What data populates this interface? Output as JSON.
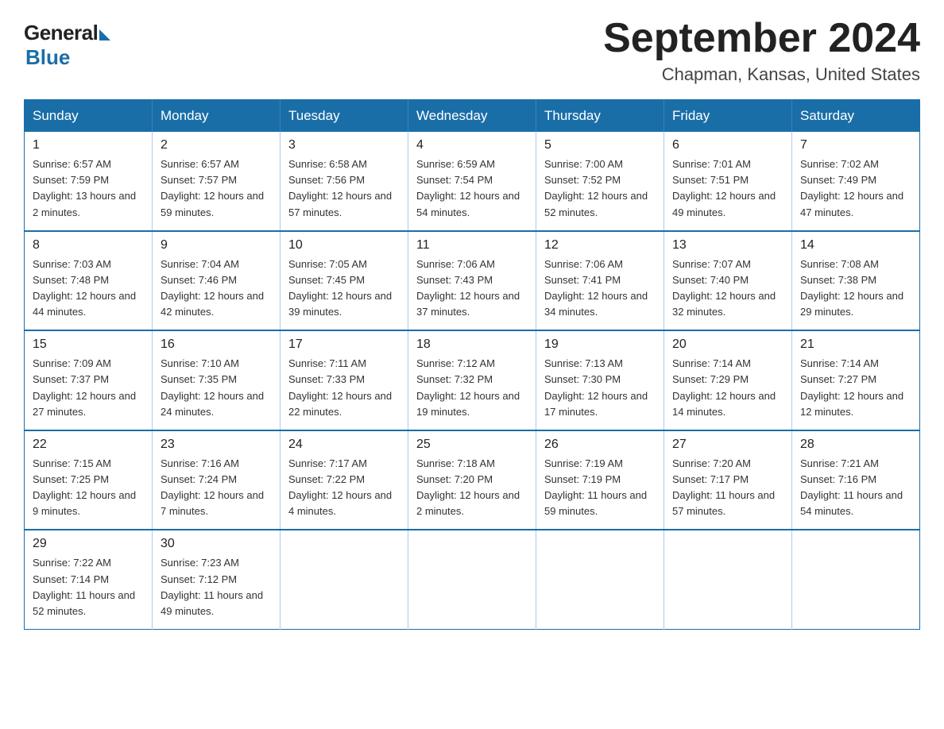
{
  "logo": {
    "general": "General",
    "blue": "Blue",
    "subtitle": "Blue"
  },
  "title": {
    "month_year": "September 2024",
    "location": "Chapman, Kansas, United States"
  },
  "days_of_week": [
    "Sunday",
    "Monday",
    "Tuesday",
    "Wednesday",
    "Thursday",
    "Friday",
    "Saturday"
  ],
  "weeks": [
    [
      {
        "day": "1",
        "sunrise": "Sunrise: 6:57 AM",
        "sunset": "Sunset: 7:59 PM",
        "daylight": "Daylight: 13 hours and 2 minutes."
      },
      {
        "day": "2",
        "sunrise": "Sunrise: 6:57 AM",
        "sunset": "Sunset: 7:57 PM",
        "daylight": "Daylight: 12 hours and 59 minutes."
      },
      {
        "day": "3",
        "sunrise": "Sunrise: 6:58 AM",
        "sunset": "Sunset: 7:56 PM",
        "daylight": "Daylight: 12 hours and 57 minutes."
      },
      {
        "day": "4",
        "sunrise": "Sunrise: 6:59 AM",
        "sunset": "Sunset: 7:54 PM",
        "daylight": "Daylight: 12 hours and 54 minutes."
      },
      {
        "day": "5",
        "sunrise": "Sunrise: 7:00 AM",
        "sunset": "Sunset: 7:52 PM",
        "daylight": "Daylight: 12 hours and 52 minutes."
      },
      {
        "day": "6",
        "sunrise": "Sunrise: 7:01 AM",
        "sunset": "Sunset: 7:51 PM",
        "daylight": "Daylight: 12 hours and 49 minutes."
      },
      {
        "day": "7",
        "sunrise": "Sunrise: 7:02 AM",
        "sunset": "Sunset: 7:49 PM",
        "daylight": "Daylight: 12 hours and 47 minutes."
      }
    ],
    [
      {
        "day": "8",
        "sunrise": "Sunrise: 7:03 AM",
        "sunset": "Sunset: 7:48 PM",
        "daylight": "Daylight: 12 hours and 44 minutes."
      },
      {
        "day": "9",
        "sunrise": "Sunrise: 7:04 AM",
        "sunset": "Sunset: 7:46 PM",
        "daylight": "Daylight: 12 hours and 42 minutes."
      },
      {
        "day": "10",
        "sunrise": "Sunrise: 7:05 AM",
        "sunset": "Sunset: 7:45 PM",
        "daylight": "Daylight: 12 hours and 39 minutes."
      },
      {
        "day": "11",
        "sunrise": "Sunrise: 7:06 AM",
        "sunset": "Sunset: 7:43 PM",
        "daylight": "Daylight: 12 hours and 37 minutes."
      },
      {
        "day": "12",
        "sunrise": "Sunrise: 7:06 AM",
        "sunset": "Sunset: 7:41 PM",
        "daylight": "Daylight: 12 hours and 34 minutes."
      },
      {
        "day": "13",
        "sunrise": "Sunrise: 7:07 AM",
        "sunset": "Sunset: 7:40 PM",
        "daylight": "Daylight: 12 hours and 32 minutes."
      },
      {
        "day": "14",
        "sunrise": "Sunrise: 7:08 AM",
        "sunset": "Sunset: 7:38 PM",
        "daylight": "Daylight: 12 hours and 29 minutes."
      }
    ],
    [
      {
        "day": "15",
        "sunrise": "Sunrise: 7:09 AM",
        "sunset": "Sunset: 7:37 PM",
        "daylight": "Daylight: 12 hours and 27 minutes."
      },
      {
        "day": "16",
        "sunrise": "Sunrise: 7:10 AM",
        "sunset": "Sunset: 7:35 PM",
        "daylight": "Daylight: 12 hours and 24 minutes."
      },
      {
        "day": "17",
        "sunrise": "Sunrise: 7:11 AM",
        "sunset": "Sunset: 7:33 PM",
        "daylight": "Daylight: 12 hours and 22 minutes."
      },
      {
        "day": "18",
        "sunrise": "Sunrise: 7:12 AM",
        "sunset": "Sunset: 7:32 PM",
        "daylight": "Daylight: 12 hours and 19 minutes."
      },
      {
        "day": "19",
        "sunrise": "Sunrise: 7:13 AM",
        "sunset": "Sunset: 7:30 PM",
        "daylight": "Daylight: 12 hours and 17 minutes."
      },
      {
        "day": "20",
        "sunrise": "Sunrise: 7:14 AM",
        "sunset": "Sunset: 7:29 PM",
        "daylight": "Daylight: 12 hours and 14 minutes."
      },
      {
        "day": "21",
        "sunrise": "Sunrise: 7:14 AM",
        "sunset": "Sunset: 7:27 PM",
        "daylight": "Daylight: 12 hours and 12 minutes."
      }
    ],
    [
      {
        "day": "22",
        "sunrise": "Sunrise: 7:15 AM",
        "sunset": "Sunset: 7:25 PM",
        "daylight": "Daylight: 12 hours and 9 minutes."
      },
      {
        "day": "23",
        "sunrise": "Sunrise: 7:16 AM",
        "sunset": "Sunset: 7:24 PM",
        "daylight": "Daylight: 12 hours and 7 minutes."
      },
      {
        "day": "24",
        "sunrise": "Sunrise: 7:17 AM",
        "sunset": "Sunset: 7:22 PM",
        "daylight": "Daylight: 12 hours and 4 minutes."
      },
      {
        "day": "25",
        "sunrise": "Sunrise: 7:18 AM",
        "sunset": "Sunset: 7:20 PM",
        "daylight": "Daylight: 12 hours and 2 minutes."
      },
      {
        "day": "26",
        "sunrise": "Sunrise: 7:19 AM",
        "sunset": "Sunset: 7:19 PM",
        "daylight": "Daylight: 11 hours and 59 minutes."
      },
      {
        "day": "27",
        "sunrise": "Sunrise: 7:20 AM",
        "sunset": "Sunset: 7:17 PM",
        "daylight": "Daylight: 11 hours and 57 minutes."
      },
      {
        "day": "28",
        "sunrise": "Sunrise: 7:21 AM",
        "sunset": "Sunset: 7:16 PM",
        "daylight": "Daylight: 11 hours and 54 minutes."
      }
    ],
    [
      {
        "day": "29",
        "sunrise": "Sunrise: 7:22 AM",
        "sunset": "Sunset: 7:14 PM",
        "daylight": "Daylight: 11 hours and 52 minutes."
      },
      {
        "day": "30",
        "sunrise": "Sunrise: 7:23 AM",
        "sunset": "Sunset: 7:12 PM",
        "daylight": "Daylight: 11 hours and 49 minutes."
      },
      null,
      null,
      null,
      null,
      null
    ]
  ]
}
